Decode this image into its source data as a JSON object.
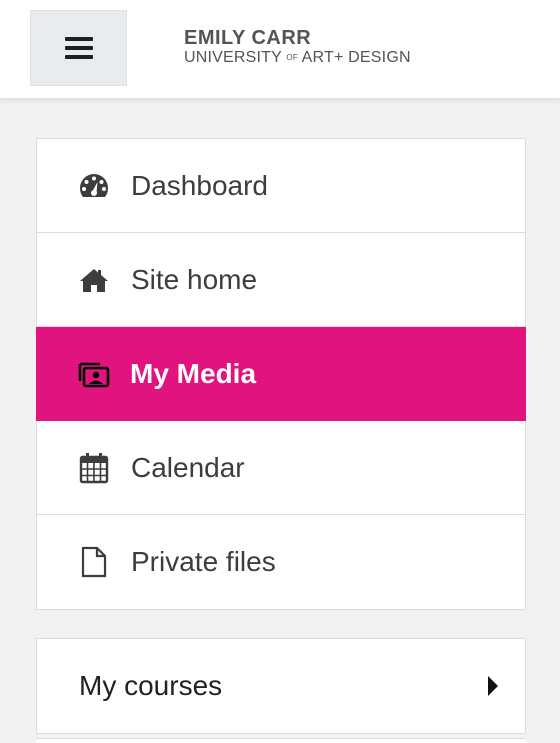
{
  "header": {
    "menu_icon": "hamburger-icon",
    "logo_line1": "EMILY CARR",
    "logo_line2_pre": "UNIVERSITY",
    "logo_line2_of": "OF",
    "logo_line2_post": "ART+ DESIGN"
  },
  "nav": {
    "items": [
      {
        "label": "Dashboard",
        "icon": "dashboard-gauge-icon",
        "active": false
      },
      {
        "label": "Site home",
        "icon": "home-icon",
        "active": false
      },
      {
        "label": "My Media",
        "icon": "media-gallery-icon",
        "active": true
      },
      {
        "label": "Calendar",
        "icon": "calendar-icon",
        "active": false
      },
      {
        "label": "Private files",
        "icon": "file-icon",
        "active": false
      }
    ]
  },
  "courses": {
    "label": "My courses",
    "icon": "caret-right-icon"
  },
  "colors": {
    "accent": "#e0137f",
    "background": "#f2f2f2",
    "text": "#3d3d3d"
  }
}
